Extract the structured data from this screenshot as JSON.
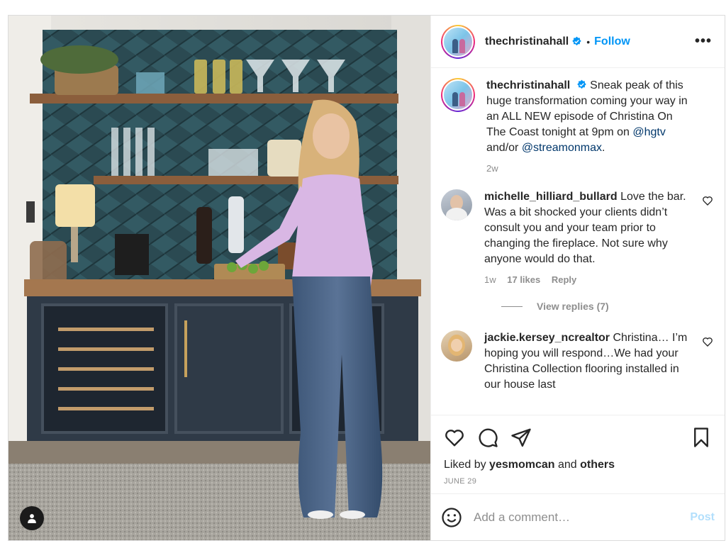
{
  "post": {
    "username": "thechristinahall",
    "follow_label": "Follow",
    "more_label": "•••",
    "caption": {
      "username": "thechristinahall",
      "text_1": "Sneak peak of this huge transformation coming your way in an ALL NEW episode of Christina On The Coast tonight at 9pm on ",
      "mention_1": "@hgtv",
      "text_2": " and/or ",
      "mention_2": "@streamonmax",
      "text_3": ".",
      "age": "2w"
    },
    "comments": [
      {
        "username": "michelle_hilliard_bullard",
        "text": "Love the bar. Was a bit shocked your clients didn’t consult you and your team prior to changing the fireplace. Not sure why anyone would do that.",
        "age": "1w",
        "likes": "17 likes",
        "reply_label": "Reply",
        "view_replies": "View replies (7)"
      },
      {
        "username": "jackie.kersey_ncrealtor",
        "text": "Christina… I’m hoping you will respond…We had your Christina Collection flooring installed in our house last"
      }
    ],
    "liked_by_prefix": "Liked by ",
    "liked_by_user": "yesmomcan",
    "liked_by_mid": " and ",
    "liked_by_others": "others",
    "date": "JUNE 29",
    "comment_placeholder": "Add a comment…",
    "post_button": "Post"
  },
  "icons": [
    "verified-badge-icon",
    "heart-icon",
    "comment-icon",
    "share-icon",
    "save-icon",
    "emoji-icon",
    "user-tag-icon",
    "more-icon"
  ],
  "colors": {
    "link": "#0095f6",
    "mention": "#00376b",
    "muted": "#8e8e8e",
    "post_disabled": "#b2dffc"
  }
}
